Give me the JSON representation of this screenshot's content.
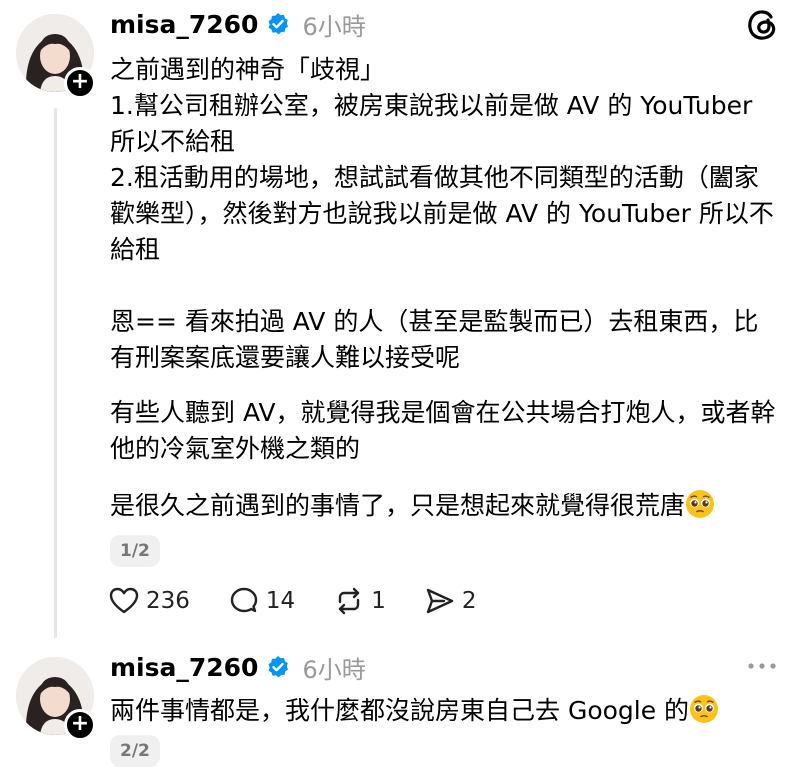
{
  "post1": {
    "username": "misa_7260",
    "timestamp": "6小時",
    "paragraphs": [
      "之前遇到的神奇「歧視」\n1.幫公司租辦公室，被房東說我以前是做 AV 的 YouTuber 所以不給租\n2.租活動用的場地，想試試看做其他不同類型的活動（闔家歡樂型），然後對方也說我以前是做 AV 的 YouTuber 所以不給租",
      "恩== 看來拍過 AV 的人（甚至是監製而已）去租東西，比有刑案案底還要讓人難以接受呢",
      "有些人聽到 AV，就覺得我是個會在公共場合打炮人，或者幹他的冷氣室外機之類的",
      "是很久之前遇到的事情了，只是想起來就覺得很荒唐"
    ],
    "page_indicator": "1/2",
    "likes": "236",
    "comments": "14",
    "reposts": "1",
    "shares": "2"
  },
  "post2": {
    "username": "misa_7260",
    "timestamp": "6小時",
    "text": "兩件事情都是，我什麼都沒說房東自己去 Google 的",
    "page_indicator": "2/2"
  },
  "icons": {
    "verified": "verified-badge-icon",
    "threads": "threads-logo-icon",
    "more": "more-options-icon",
    "like": "heart-icon",
    "comment": "speech-bubble-icon",
    "repost": "repost-icon",
    "share": "send-icon",
    "emoji": "pleading-face-emoji"
  },
  "colors": {
    "verified": "#0095f6",
    "muted": "#999999"
  }
}
